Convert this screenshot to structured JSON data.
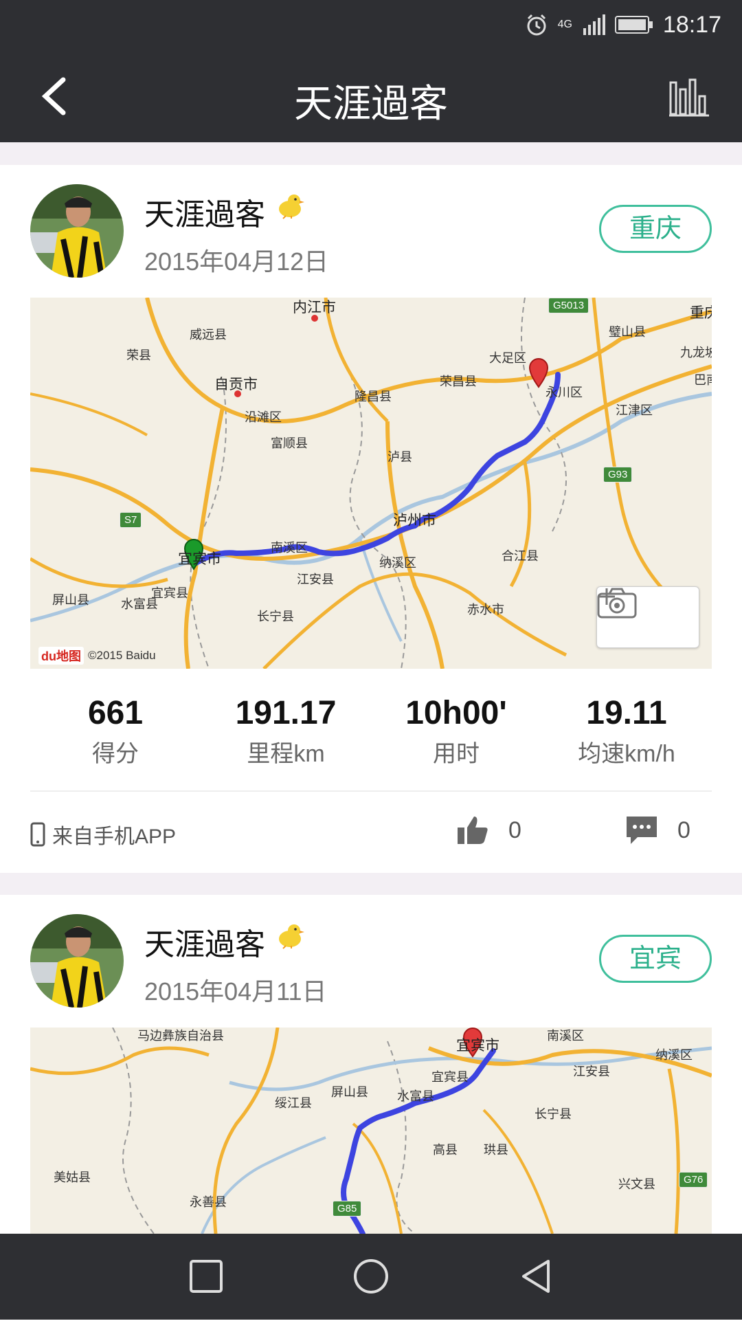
{
  "status_bar": {
    "time": "18:17",
    "network": "4G"
  },
  "header": {
    "title": "天涯過客"
  },
  "posts": [
    {
      "username": "天涯過客",
      "date": "2015年04月12日",
      "city": "重庆",
      "map_labels": [
        "内江市",
        "威远县",
        "荣县",
        "自贡市",
        "沿滩区",
        "富顺县",
        "隆昌县",
        "荣昌县",
        "大足区",
        "璧山县",
        "重庆",
        "九龙坡",
        "巴南",
        "江津区",
        "泸县",
        "泸州市",
        "南溪区",
        "宜宾市",
        "宜宾县",
        "江安县",
        "纳溪区",
        "合江县",
        "屏山县",
        "水富县",
        "长宁县",
        "赤水市",
        "永川区"
      ],
      "road_shields": [
        "G5013",
        "S7",
        "G93"
      ],
      "copyright": "©2015 Baidu",
      "baidu_logo": "du地图",
      "stats": [
        {
          "value": "661",
          "label": "得分"
        },
        {
          "value": "191.17",
          "label": "里程km"
        },
        {
          "value": "10h00'",
          "label": "用时"
        },
        {
          "value": "19.11",
          "label": "均速km/h"
        }
      ],
      "source": "来自手机APP",
      "likes": "0",
      "comments": "0"
    },
    {
      "username": "天涯過客",
      "date": "2015年04月11日",
      "city": "宜宾",
      "map_labels": [
        "马边彝族自治县",
        "宜宾市",
        "南溪区",
        "纳溪区",
        "江安县",
        "宜宾县",
        "屏山县",
        "水富县",
        "绥江县",
        "长宁县",
        "高县",
        "珙县",
        "美姑县",
        "兴文县",
        "永善县"
      ],
      "road_shields": [
        "G76",
        "G85"
      ]
    }
  ],
  "colors": {
    "accent": "#2bb08b",
    "route": "#3d44e0",
    "dark_bar": "#2e2f33"
  }
}
